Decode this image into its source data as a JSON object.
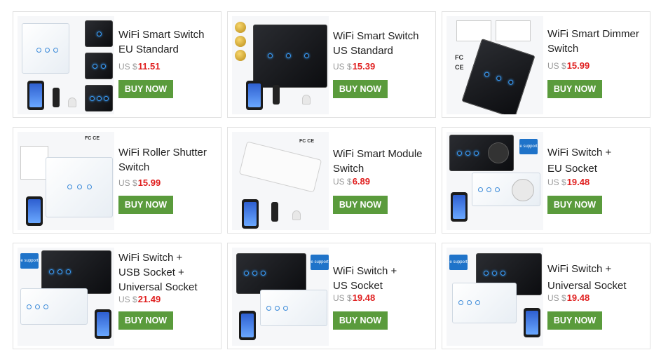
{
  "products": [
    {
      "title_lines": [
        "WiFi Smart Switch",
        "EU Standard"
      ],
      "currency": "US $",
      "price": "11.51",
      "button": "BUY NOW"
    },
    {
      "title_lines": [
        "WiFi Smart Switch",
        "US Standard"
      ],
      "currency": "US $",
      "price": "15.39",
      "button": "BUY NOW"
    },
    {
      "title_lines": [
        "WiFi Smart Dimmer",
        "Switch"
      ],
      "currency": "US $",
      "price": "15.99",
      "button": "BUY NOW"
    },
    {
      "title_lines": [
        "WiFi Roller Shutter",
        "Switch"
      ],
      "currency": "US $",
      "price": "15.99",
      "button": "BUY NOW"
    },
    {
      "title_lines": [
        "WiFi Smart Module",
        "Switch"
      ],
      "currency": "US $",
      "price": "6.89",
      "button": "BUY NOW"
    },
    {
      "title_lines": [
        "WiFi Switch +",
        "EU Socket"
      ],
      "currency": "US $",
      "price": "19.48",
      "button": "BUY NOW"
    },
    {
      "title_lines": [
        "WiFi Switch +",
        "USB Socket +",
        "Universal Socket"
      ],
      "currency": "US $",
      "price": "21.49",
      "button": "BUY NOW"
    },
    {
      "title_lines": [
        "WiFi Switch +",
        "US Socket"
      ],
      "currency": "US $",
      "price": "19.48",
      "button": "BUY NOW"
    },
    {
      "title_lines": [
        "WiFi Switch +",
        "Universal Socket"
      ],
      "currency": "US $",
      "price": "19.48",
      "button": "BUY NOW"
    }
  ],
  "icons": {
    "cert": "FC CE",
    "esupport": "e support"
  },
  "colors": {
    "button_bg": "#5a9b3c",
    "price_red": "#e02020",
    "card_border": "#e2e2e2"
  }
}
